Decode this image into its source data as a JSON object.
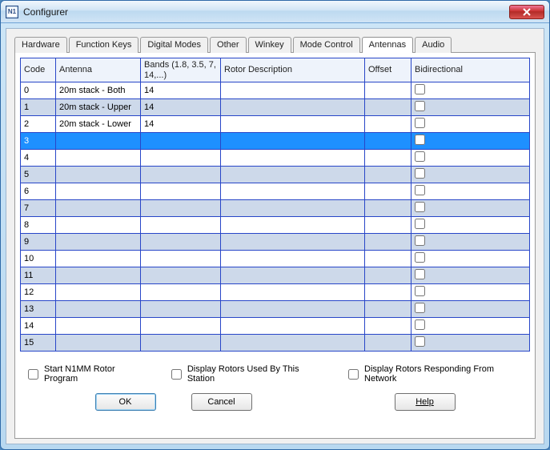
{
  "window": {
    "title": "Configurer",
    "app_icon_label": "N1"
  },
  "tabs": {
    "items": [
      {
        "label": "Hardware"
      },
      {
        "label": "Function Keys"
      },
      {
        "label": "Digital Modes"
      },
      {
        "label": "Other"
      },
      {
        "label": "Winkey"
      },
      {
        "label": "Mode Control"
      },
      {
        "label": "Antennas",
        "active": true
      },
      {
        "label": "Audio"
      }
    ]
  },
  "table": {
    "headers": {
      "code": "Code",
      "antenna": "Antenna",
      "bands": "Bands (1.8, 3.5, 7, 14,...)",
      "rotor": "Rotor Description",
      "offset": "Offset",
      "bidi": "Bidirectional"
    },
    "selected_index": 3,
    "rows": [
      {
        "code": "0",
        "antenna": "20m stack - Both",
        "bands": "14",
        "rotor": "",
        "offset": "",
        "bidi": false
      },
      {
        "code": "1",
        "antenna": "20m stack - Upper",
        "bands": "14",
        "rotor": "",
        "offset": "",
        "bidi": false
      },
      {
        "code": "2",
        "antenna": "20m stack - Lower",
        "bands": "14",
        "rotor": "",
        "offset": "",
        "bidi": false
      },
      {
        "code": "3",
        "antenna": "",
        "bands": "",
        "rotor": "",
        "offset": "",
        "bidi": false
      },
      {
        "code": "4",
        "antenna": "",
        "bands": "",
        "rotor": "",
        "offset": "",
        "bidi": false
      },
      {
        "code": "5",
        "antenna": "",
        "bands": "",
        "rotor": "",
        "offset": "",
        "bidi": false
      },
      {
        "code": "6",
        "antenna": "",
        "bands": "",
        "rotor": "",
        "offset": "",
        "bidi": false
      },
      {
        "code": "7",
        "antenna": "",
        "bands": "",
        "rotor": "",
        "offset": "",
        "bidi": false
      },
      {
        "code": "8",
        "antenna": "",
        "bands": "",
        "rotor": "",
        "offset": "",
        "bidi": false
      },
      {
        "code": "9",
        "antenna": "",
        "bands": "",
        "rotor": "",
        "offset": "",
        "bidi": false
      },
      {
        "code": "10",
        "antenna": "",
        "bands": "",
        "rotor": "",
        "offset": "",
        "bidi": false
      },
      {
        "code": "11",
        "antenna": "",
        "bands": "",
        "rotor": "",
        "offset": "",
        "bidi": false
      },
      {
        "code": "12",
        "antenna": "",
        "bands": "",
        "rotor": "",
        "offset": "",
        "bidi": false
      },
      {
        "code": "13",
        "antenna": "",
        "bands": "",
        "rotor": "",
        "offset": "",
        "bidi": false
      },
      {
        "code": "14",
        "antenna": "",
        "bands": "",
        "rotor": "",
        "offset": "",
        "bidi": false
      },
      {
        "code": "15",
        "antenna": "",
        "bands": "",
        "rotor": "",
        "offset": "",
        "bidi": false
      }
    ]
  },
  "options": {
    "start_rotor": {
      "label": "Start N1MM Rotor Program",
      "checked": false
    },
    "display_used": {
      "label": "Display Rotors Used By This Station",
      "checked": false
    },
    "display_network": {
      "label": "Display Rotors Responding From Network",
      "checked": false
    }
  },
  "buttons": {
    "ok": "OK",
    "cancel": "Cancel",
    "help": "Help"
  }
}
